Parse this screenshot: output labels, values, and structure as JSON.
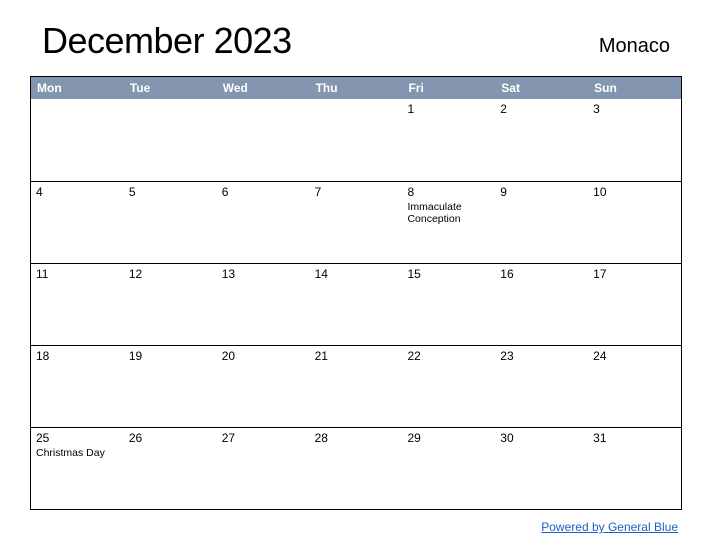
{
  "header": {
    "title": "December 2023",
    "region": "Monaco"
  },
  "weekdays": [
    "Mon",
    "Tue",
    "Wed",
    "Thu",
    "Fri",
    "Sat",
    "Sun"
  ],
  "weeks": [
    [
      {
        "day": "",
        "holiday": ""
      },
      {
        "day": "",
        "holiday": ""
      },
      {
        "day": "",
        "holiday": ""
      },
      {
        "day": "",
        "holiday": ""
      },
      {
        "day": "1",
        "holiday": ""
      },
      {
        "day": "2",
        "holiday": ""
      },
      {
        "day": "3",
        "holiday": ""
      }
    ],
    [
      {
        "day": "4",
        "holiday": ""
      },
      {
        "day": "5",
        "holiday": ""
      },
      {
        "day": "6",
        "holiday": ""
      },
      {
        "day": "7",
        "holiday": ""
      },
      {
        "day": "8",
        "holiday": "Immaculate Conception"
      },
      {
        "day": "9",
        "holiday": ""
      },
      {
        "day": "10",
        "holiday": ""
      }
    ],
    [
      {
        "day": "11",
        "holiday": ""
      },
      {
        "day": "12",
        "holiday": ""
      },
      {
        "day": "13",
        "holiday": ""
      },
      {
        "day": "14",
        "holiday": ""
      },
      {
        "day": "15",
        "holiday": ""
      },
      {
        "day": "16",
        "holiday": ""
      },
      {
        "day": "17",
        "holiday": ""
      }
    ],
    [
      {
        "day": "18",
        "holiday": ""
      },
      {
        "day": "19",
        "holiday": ""
      },
      {
        "day": "20",
        "holiday": ""
      },
      {
        "day": "21",
        "holiday": ""
      },
      {
        "day": "22",
        "holiday": ""
      },
      {
        "day": "23",
        "holiday": ""
      },
      {
        "day": "24",
        "holiday": ""
      }
    ],
    [
      {
        "day": "25",
        "holiday": "Christmas Day"
      },
      {
        "day": "26",
        "holiday": ""
      },
      {
        "day": "27",
        "holiday": ""
      },
      {
        "day": "28",
        "holiday": ""
      },
      {
        "day": "29",
        "holiday": ""
      },
      {
        "day": "30",
        "holiday": ""
      },
      {
        "day": "31",
        "holiday": ""
      }
    ]
  ],
  "footer": {
    "link_text": "Powered by General Blue"
  }
}
